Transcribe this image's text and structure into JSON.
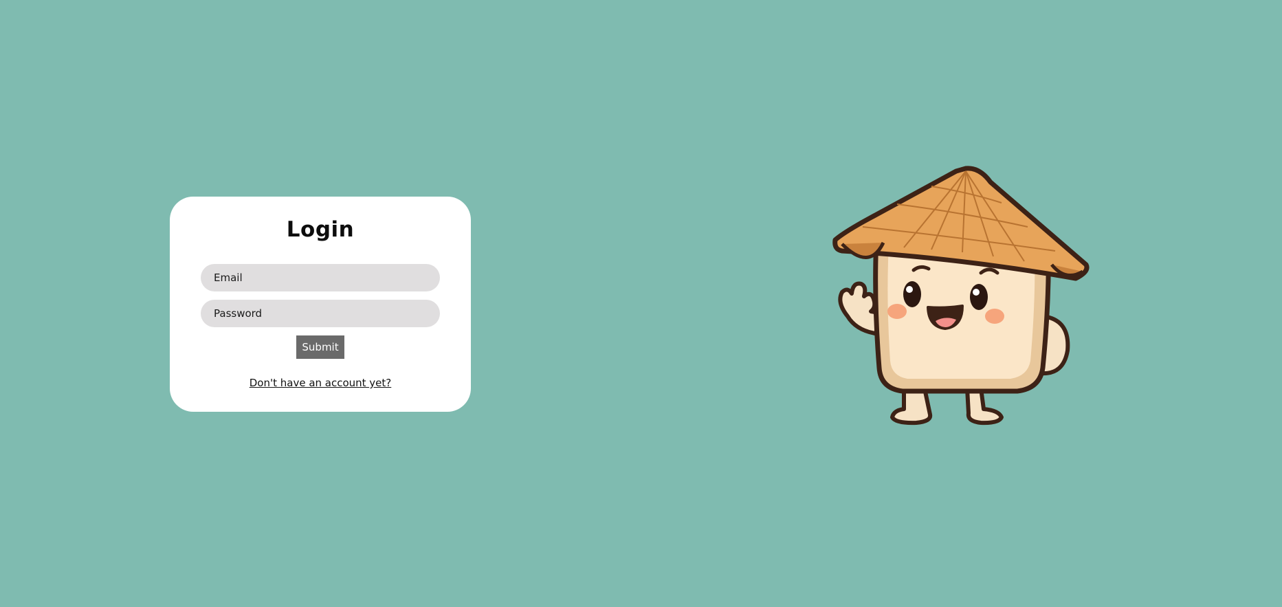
{
  "login": {
    "title": "Login",
    "email_placeholder": "Email",
    "password_placeholder": "Password",
    "submit_label": "Submit",
    "signup_link": "Don't have an account yet?"
  },
  "colors": {
    "background": "#7fbbb0",
    "card": "#ffffff",
    "input": "#e0dedf",
    "button": "#6a6a6a"
  },
  "illustration": {
    "name": "waving-mascot-with-conical-hat"
  }
}
